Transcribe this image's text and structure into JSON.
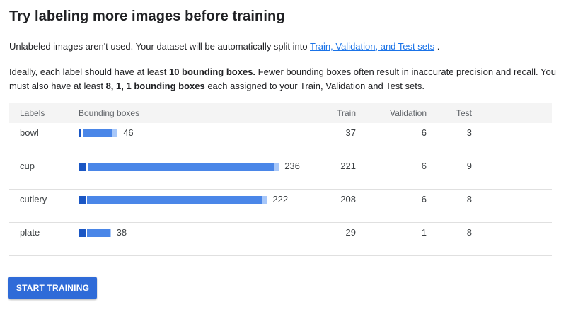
{
  "title": "Try labeling more images before training",
  "intro": {
    "text_before": "Unlabeled images aren't used. Your dataset will be automatically split into ",
    "link": "Train, Validation, and Test sets",
    "text_after": " ."
  },
  "guidance": {
    "t1": "Ideally, each label should have at least ",
    "b1": "10 bounding boxes.",
    "t2": " Fewer bounding boxes often result in inaccurate precision and recall. You must also have at least ",
    "b2": "8, 1, 1 bounding boxes",
    "t3": " each assigned to your Train, Validation and Test sets."
  },
  "table": {
    "headers": {
      "labels": "Labels",
      "boxes": "Bounding boxes",
      "train": "Train",
      "validation": "Validation",
      "test": "Test"
    },
    "rows": [
      {
        "label": "bowl",
        "boxes": 46,
        "train": 37,
        "validation": 6,
        "test": 3
      },
      {
        "label": "cup",
        "boxes": 236,
        "train": 221,
        "validation": 6,
        "test": 9
      },
      {
        "label": "cutlery",
        "boxes": 222,
        "train": 208,
        "validation": 6,
        "test": 8
      },
      {
        "label": "plate",
        "boxes": 38,
        "train": 29,
        "validation": 1,
        "test": 8
      }
    ]
  },
  "colors": {
    "bar_dark": "#1a56c4",
    "bar_main": "#4a86e8",
    "bar_light": "#a7c7f9",
    "link": "#1a73e8",
    "button": "#2f6bd8"
  },
  "button": {
    "label": "START TRAINING"
  }
}
